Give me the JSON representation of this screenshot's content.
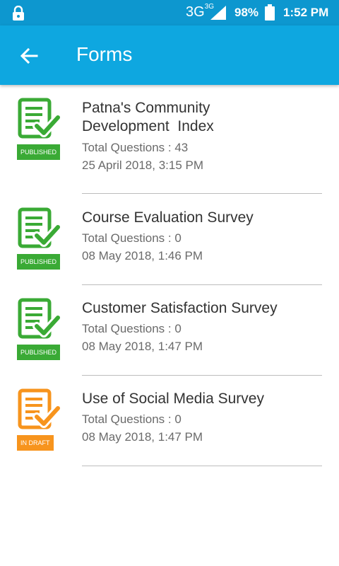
{
  "status_bar": {
    "network": "3G",
    "network_sup": "3G",
    "battery": "98%",
    "time": "1:52 PM"
  },
  "app_bar": {
    "title": "Forms"
  },
  "colors": {
    "published": "#3aaa35",
    "draft": "#f7941d",
    "app_bar": "#0ea7e0",
    "status_bar": "#0d97cf"
  },
  "forms": [
    {
      "title_line1": "Patna's Community",
      "title_line2": "Development  Index",
      "questions": "Total Questions : 43",
      "date": "25 April 2018, 3:15 PM",
      "status": "PUBLISHED"
    },
    {
      "title_line1": "Course Evaluation Survey",
      "questions": "Total Questions : 0",
      "date": "08 May 2018, 1:46 PM",
      "status": "PUBLISHED"
    },
    {
      "title_line1": "Customer Satisfaction Survey",
      "questions": "Total Questions : 0",
      "date": "08 May 2018, 1:47 PM",
      "status": "PUBLISHED"
    },
    {
      "title_line1": "Use of Social Media Survey",
      "questions": "Total Questions : 0",
      "date": "08 May 2018, 1:47 PM",
      "status": "IN DRAFT"
    }
  ]
}
